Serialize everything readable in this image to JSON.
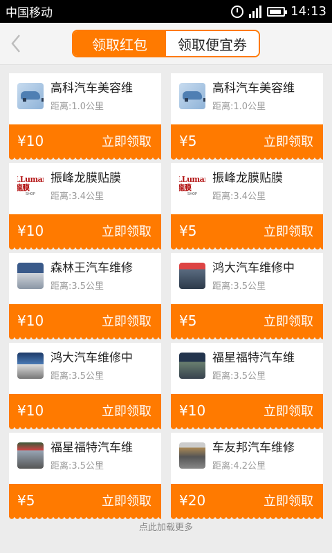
{
  "status_bar": {
    "carrier": "中国移动",
    "time": "14:13"
  },
  "header": {
    "tabs": [
      {
        "label": "领取红包",
        "active": true
      },
      {
        "label": "领取便宜券",
        "active": false
      }
    ]
  },
  "coupons": [
    {
      "name": "高科汽车美容维",
      "distance": "距离:1.0公里",
      "price": "¥10",
      "action": "立即领取",
      "thumb": "car-icon"
    },
    {
      "name": "高科汽车美容维",
      "distance": "距离:1.0公里",
      "price": "¥5",
      "action": "立即领取",
      "thumb": "car-icon"
    },
    {
      "name": "振峰龙膜贴膜",
      "distance": "距离:3.4公里",
      "price": "¥10",
      "action": "立即领取",
      "thumb": "llumar-logo"
    },
    {
      "name": "振峰龙膜贴膜",
      "distance": "距离:3.4公里",
      "price": "¥5",
      "action": "立即领取",
      "thumb": "llumar-logo"
    },
    {
      "name": "森林王汽车维修",
      "distance": "距离:3.5公里",
      "price": "¥10",
      "action": "立即领取",
      "thumb": "shop-photo"
    },
    {
      "name": "鸿大汽车维修中",
      "distance": "距离:3.5公里",
      "price": "¥5",
      "action": "立即领取",
      "thumb": "shop-photo"
    },
    {
      "name": "鸿大汽车维修中",
      "distance": "距离:3.5公里",
      "price": "¥10",
      "action": "立即领取",
      "thumb": "shop-photo"
    },
    {
      "name": "福星福特汽车维",
      "distance": "距离:3.5公里",
      "price": "¥10",
      "action": "立即领取",
      "thumb": "shop-photo"
    },
    {
      "name": "福星福特汽车维",
      "distance": "距离:3.5公里",
      "price": "¥5",
      "action": "立即领取",
      "thumb": "shop-photo"
    },
    {
      "name": "车友邦汽车维修",
      "distance": "距离:4.2公里",
      "price": "¥20",
      "action": "立即领取",
      "thumb": "shop-photo"
    }
  ],
  "footer": {
    "load_more": "点此加载更多"
  },
  "colors": {
    "accent": "#ff7a00",
    "background": "#ececec"
  },
  "llumar_logo_text": "LLumar 龍膜"
}
